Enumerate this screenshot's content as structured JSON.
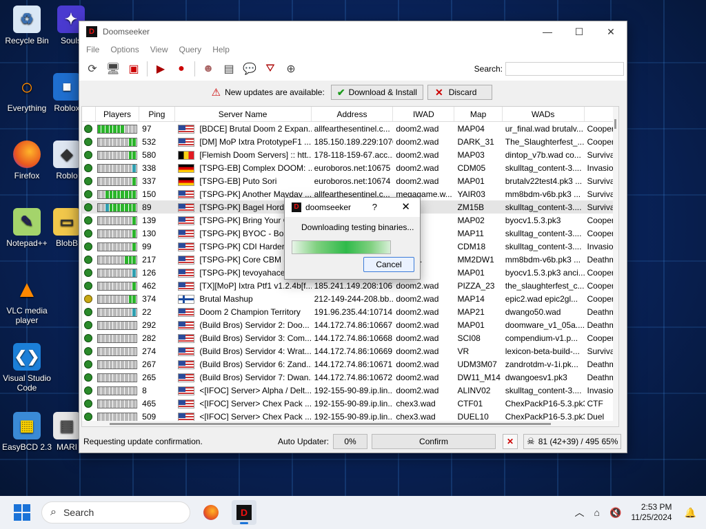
{
  "desktop": {
    "icons": [
      {
        "label": "Recycle Bin",
        "name": "recycle-bin-icon"
      },
      {
        "label": "Souls",
        "name": "souls-icon"
      },
      {
        "label": "Everything",
        "name": "everything-icon"
      },
      {
        "label": "Roblox",
        "name": "roblox-icon"
      },
      {
        "label": "Firefox",
        "name": "firefox-icon"
      },
      {
        "label": "Roblo",
        "name": "roblox-studio-icon"
      },
      {
        "label": "Notepad++",
        "name": "notepadpp-icon"
      },
      {
        "label": "BlobB",
        "name": "blobb-icon"
      },
      {
        "label": "VLC media player",
        "name": "vlc-icon"
      },
      {
        "label": "Visual Studio Code",
        "name": "vscode-icon"
      },
      {
        "label": "EasyBCD 2.3",
        "name": "easybcd-icon"
      },
      {
        "label": "MARI",
        "name": "mari-icon"
      }
    ]
  },
  "window": {
    "title": "Doomseeker",
    "menu": [
      "File",
      "Options",
      "View",
      "Query",
      "Help"
    ],
    "search_label": "Search:",
    "search_value": "",
    "updates": {
      "message": "New updates are available:",
      "download_label": "Download & Install",
      "discard_label": "Discard"
    },
    "columns": [
      "Players",
      "Ping",
      "Server Name",
      "Address",
      "IWAD",
      "Map",
      "WADs"
    ],
    "rows": [
      {
        "status": "ok",
        "players": [
          1,
          1,
          1,
          1,
          1,
          1,
          1,
          0,
          0,
          0
        ],
        "ping": "97",
        "flag": "us",
        "name": "[BDCE] Brutal Doom 2 Expan...",
        "address": "allfearthesentinel.c...",
        "iwad": "doom2.wad",
        "map": "MAP04",
        "wads": "ur_final.wad brutalv...",
        "mode": "Cooper"
      },
      {
        "status": "ok",
        "players": [
          0,
          0,
          0,
          0,
          0,
          0,
          0,
          0,
          1,
          1
        ],
        "ping": "532",
        "flag": "us",
        "name": "[DM] MoP Ixtra PrototypeF1 ...",
        "address": "185.150.189.229:10703",
        "iwad": "doom2.wad",
        "map": "DARK_31",
        "wads": "The_Slaughterfest_...",
        "mode": "Cooper"
      },
      {
        "status": "ok",
        "players": [
          0,
          0,
          0,
          0,
          0,
          0,
          0,
          0,
          1,
          1
        ],
        "ping": "580",
        "flag": "be",
        "name": "[Flemish Doom Servers] :: htt...",
        "address": "178-118-159-67.acc...",
        "iwad": "doom2.wad",
        "map": "MAP03",
        "wads": "dintop_v7b.wad co...",
        "mode": "Survival"
      },
      {
        "status": "ok",
        "players": [
          0,
          0,
          0,
          0,
          0,
          0,
          0,
          0,
          0,
          2
        ],
        "ping": "338",
        "flag": "de",
        "name": "[TSPG-EB] Complex DOOM: ...",
        "address": "euroboros.net:10675",
        "iwad": "doom2.wad",
        "map": "CDM05",
        "wads": "skulltag_content-3....",
        "mode": "Invasion"
      },
      {
        "status": "ok",
        "players": [
          0,
          0,
          0,
          0,
          0,
          0,
          0,
          0,
          0,
          1
        ],
        "ping": "337",
        "flag": "de",
        "name": "[TSPG-EB] Puto Sori",
        "address": "euroboros.net:10674",
        "iwad": "doom2.wad",
        "map": "MAP01",
        "wads": "brutalv22test4.pk3 ...",
        "mode": "Survival"
      },
      {
        "status": "ok",
        "players": [
          0,
          0,
          1,
          1,
          1,
          1,
          1,
          1,
          1,
          1
        ],
        "ping": "150",
        "flag": "us",
        "name": "[TSPG-PK] Another Mayday ...",
        "address": "allfearthesentinel.c...",
        "iwad": "megagame.w...",
        "map": "YAIR03",
        "wads": "mm8bdm-v6b.pk3 ...",
        "mode": "Survival"
      },
      {
        "status": "ok",
        "players": [
          0,
          0,
          2,
          1,
          1,
          1,
          1,
          1,
          1,
          1
        ],
        "ping": "89",
        "flag": "us",
        "name": "[TSPG-PK] Bagel Horde I",
        "address": "",
        "iwad": "wad",
        "map": "ZM15B",
        "wads": "skulltag_content-3....",
        "mode": "Survival",
        "selected": true
      },
      {
        "status": "ok",
        "players": [
          0,
          0,
          0,
          0,
          0,
          0,
          0,
          0,
          0,
          1
        ],
        "ping": "139",
        "flag": "us",
        "name": "[TSPG-PK] Bring Your Ov",
        "address": "",
        "iwad": "wad",
        "map": "MAP02",
        "wads": "byocv1.5.3.pk3",
        "mode": "Cooper"
      },
      {
        "status": "ok",
        "players": [
          0,
          0,
          0,
          0,
          0,
          0,
          0,
          0,
          0,
          1
        ],
        "ping": "130",
        "flag": "us",
        "name": "[TSPG-PK] BYOC - Boss",
        "address": "",
        "iwad": "wad",
        "map": "MAP11",
        "wads": "skulltag_content-3....",
        "mode": "Cooper"
      },
      {
        "status": "ok",
        "players": [
          0,
          0,
          0,
          0,
          0,
          0,
          0,
          0,
          0,
          1
        ],
        "ping": "99",
        "flag": "us",
        "name": "[TSPG-PK] CDI Harder F",
        "address": "",
        "iwad": "wad",
        "map": "CDM18",
        "wads": "skulltag_content-3....",
        "mode": "Invasion"
      },
      {
        "status": "ok",
        "players": [
          0,
          0,
          0,
          0,
          0,
          0,
          0,
          1,
          1,
          1
        ],
        "ping": "217",
        "flag": "us",
        "name": "[TSPG-PK] Core CBM an",
        "address": "",
        "iwad": "me.w...",
        "map": "MM2DW1",
        "wads": "mm8bdm-v6b.pk3 ...",
        "mode": "Deathm"
      },
      {
        "status": "ok",
        "players": [
          0,
          0,
          0,
          0,
          0,
          0,
          0,
          0,
          0,
          2
        ],
        "ping": "126",
        "flag": "us",
        "name": "[TSPG-PK] tevoyahacerf",
        "address": "",
        "iwad": "wad",
        "map": "MAP01",
        "wads": "byocv1.5.3.pk3 anci...",
        "mode": "Cooper"
      },
      {
        "status": "ok",
        "players": [
          0,
          0,
          0,
          0,
          0,
          0,
          0,
          0,
          0,
          1
        ],
        "ping": "462",
        "flag": "us",
        "name": "[TX][MoP] Ixtra Ptf1 v1.2.4b[f...",
        "address": "185.241.149.208:10674",
        "iwad": "doom2.wad",
        "map": "PIZZA_23",
        "wads": "the_slaughterfest_c...",
        "mode": "Cooper"
      },
      {
        "status": "lock",
        "players": [
          0,
          0,
          0,
          0,
          0,
          0,
          0,
          0,
          1,
          1
        ],
        "ping": "374",
        "flag": "fi",
        "name": "Brutal Mashup",
        "address": "212-149-244-208.bb...",
        "iwad": "doom2.wad",
        "map": "MAP14",
        "wads": "epic2.wad epic2gl...",
        "mode": "Cooper"
      },
      {
        "status": "ok",
        "players": [
          0,
          0,
          0,
          0,
          0,
          0,
          0,
          0,
          0,
          2
        ],
        "ping": "22",
        "flag": "us",
        "name": "Doom 2 Champion Territory",
        "address": "191.96.235.44:10714",
        "iwad": "doom2.wad",
        "map": "MAP21",
        "wads": "dwango50.wad",
        "mode": "Deathm"
      },
      {
        "status": "ok",
        "players": [
          0,
          0,
          0,
          0,
          0,
          0,
          0,
          0,
          0,
          0
        ],
        "ping": "292",
        "flag": "us",
        "name": "(Build Bros) Servidor 2: Doo...",
        "address": "144.172.74.86:10667",
        "iwad": "doom2.wad",
        "map": "MAP01",
        "wads": "doomware_v1_05a....",
        "mode": "Deathm"
      },
      {
        "status": "ok",
        "players": [
          0,
          0,
          0,
          0,
          0,
          0,
          0,
          0,
          0,
          0
        ],
        "ping": "282",
        "flag": "us",
        "name": "(Build Bros) Servidor 3: Com...",
        "address": "144.172.74.86:10668",
        "iwad": "doom2.wad",
        "map": "SCI08",
        "wads": "compendium-v1.p...",
        "mode": "Cooper"
      },
      {
        "status": "ok",
        "players": [
          0,
          0,
          0,
          0,
          0,
          0,
          0,
          0,
          0,
          0
        ],
        "ping": "274",
        "flag": "us",
        "name": "(Build Bros) Servidor 4: Wrat...",
        "address": "144.172.74.86:10669",
        "iwad": "doom2.wad",
        "map": "VR",
        "wads": "lexicon-beta-build-...",
        "mode": "Survival"
      },
      {
        "status": "ok",
        "players": [
          0,
          0,
          0,
          0,
          0,
          0,
          0,
          0,
          0,
          0
        ],
        "ping": "267",
        "flag": "us",
        "name": "(Build Bros) Servidor 6: Zand...",
        "address": "144.172.74.86:10671",
        "iwad": "doom2.wad",
        "map": "UDM3M07",
        "wads": "zandrotdm-v-1i.pk...",
        "mode": "Deathm"
      },
      {
        "status": "ok",
        "players": [
          0,
          0,
          0,
          0,
          0,
          0,
          0,
          0,
          0,
          0
        ],
        "ping": "265",
        "flag": "us",
        "name": "(Build Bros) Servidor 7: Dwan...",
        "address": "144.172.74.86:10672",
        "iwad": "doom2.wad",
        "map": "DW11_M14",
        "wads": "dwangoesv1.pk3",
        "mode": "Deathm"
      },
      {
        "status": "ok",
        "players": [
          0,
          0,
          0,
          0,
          0,
          0,
          0,
          0,
          0,
          0
        ],
        "ping": "8",
        "flag": "us",
        "name": "<[IFOC] Server> Alpha / Delt...",
        "address": "192-155-90-89.ip.lin...",
        "iwad": "doom2.wad",
        "map": "ALINV02",
        "wads": "skulltag_content-3....",
        "mode": "Invasion"
      },
      {
        "status": "ok",
        "players": [
          0,
          0,
          0,
          0,
          0,
          0,
          0,
          0,
          0,
          0
        ],
        "ping": "465",
        "flag": "us",
        "name": "<[IFOC] Server> Chex Pack ...",
        "address": "192-155-90-89.ip.lin...",
        "iwad": "chex3.wad",
        "map": "CTF01",
        "wads": "ChexPackP16-5.3.pk3",
        "mode": "CTF"
      },
      {
        "status": "ok",
        "players": [
          0,
          0,
          0,
          0,
          0,
          0,
          0,
          0,
          0,
          0
        ],
        "ping": "509",
        "flag": "us",
        "name": "<[IFOC] Server> Chex Pack ...",
        "address": "192-155-90-89.ip.lin...",
        "iwad": "chex3.wad",
        "map": "DUEL10",
        "wads": "ChexPackP16-5.3.pk3",
        "mode": "Duel"
      }
    ],
    "status": {
      "text": "Requesting update confirmation.",
      "auto_updater_label": "Auto Updater:",
      "auto_updater_pct": "0%",
      "confirm_label": "Confirm",
      "players_summary": "81 (42+39) / 495 65%"
    }
  },
  "dialog": {
    "title": "doomseeker",
    "help": "?",
    "message": "Downloading testing binaries...",
    "cancel_label": "Cancel"
  },
  "taskbar": {
    "search_placeholder": "Search",
    "time": "2:53 PM",
    "date": "11/25/2024"
  }
}
